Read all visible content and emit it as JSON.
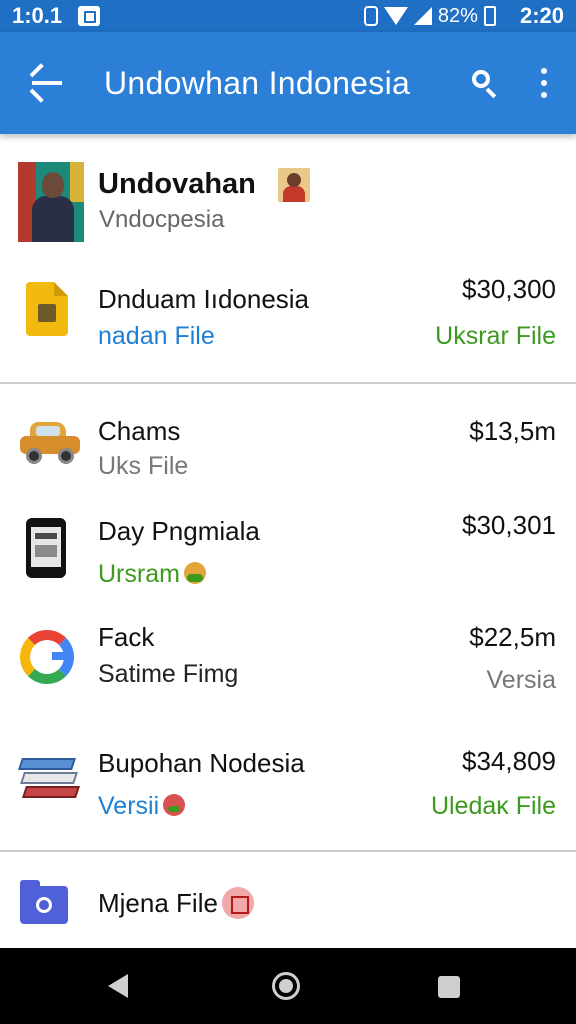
{
  "status_bar": {
    "time_left": "1:0.1",
    "battery_pct": "82%",
    "time_right": "2:20"
  },
  "app_bar": {
    "title": "Undowhan Indonesia"
  },
  "profile": {
    "name": "Undovahan",
    "subtitle": "Vndocpesia"
  },
  "rows": [
    {
      "title": "Dnduam Iıdonesia",
      "subtitle": "nadan File",
      "amount": "$30,300",
      "right_sub": "Uksrar File",
      "icon": "document-icon"
    },
    {
      "title": "Chams",
      "subtitle": "Uks File",
      "amount": "$13,5m",
      "right_sub": "",
      "icon": "car-icon"
    },
    {
      "title": "Day Pngmiala",
      "subtitle": "Ursram",
      "amount": "$30,301",
      "right_sub": "",
      "icon": "phone-icon"
    },
    {
      "title": "Fack",
      "subtitle": "Satime Fimg",
      "amount": "$22,5m",
      "right_sub": "Versia",
      "icon": "google-icon"
    },
    {
      "title": "Bupohan Nodesia",
      "subtitle": "Versii",
      "amount": "$34,809",
      "right_sub": "Uledaĸ File",
      "icon": "books-icon"
    },
    {
      "title": "Mjena File",
      "subtitle": "",
      "amount": "",
      "right_sub": "",
      "icon": "folder-icon"
    }
  ],
  "colors": {
    "app_bar": "#2b7fd6",
    "status_bar": "#1f6fc4",
    "link_blue": "#1f7fd2",
    "green": "#3c9a1f",
    "red": "#b41a1a"
  }
}
